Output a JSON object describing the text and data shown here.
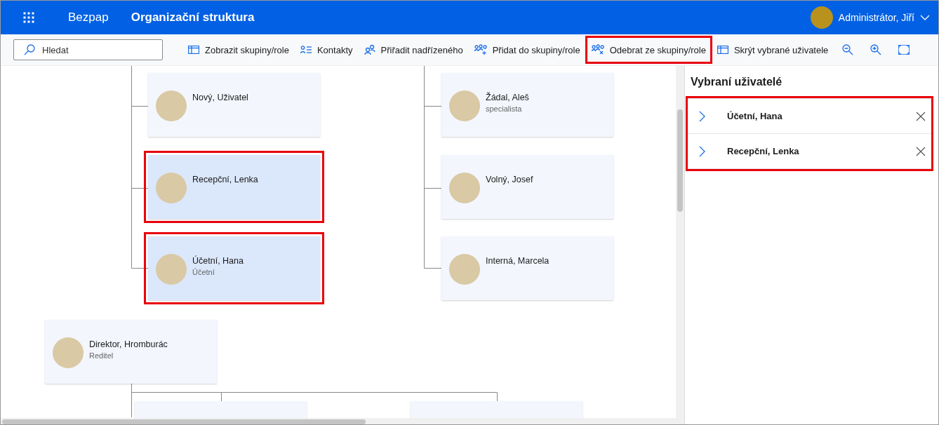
{
  "header": {
    "app_name": "Bezpap",
    "title": "Organizační struktura",
    "user": "Administrátor, Jiří"
  },
  "toolbar": {
    "search": {
      "placeholder": "Hledat"
    },
    "buttons": [
      {
        "label": "Zobrazit skupiny/role",
        "kind": "panel",
        "highlighted": false
      },
      {
        "label": "Kontakty",
        "kind": "contacts",
        "highlighted": false
      },
      {
        "label": "Přiřadit nadřízeného",
        "kind": "assign",
        "highlighted": false
      },
      {
        "label": "Přidat do skupiny/role",
        "kind": "add",
        "highlighted": false
      },
      {
        "label": "Odebrat ze skupiny/role",
        "kind": "remove",
        "highlighted": true
      },
      {
        "label": "Skrýt vybrané uživatele",
        "kind": "panel",
        "highlighted": false
      },
      {
        "kind": "zoom-out"
      },
      {
        "kind": "zoom-in"
      },
      {
        "kind": "fit"
      }
    ]
  },
  "chart": {
    "cards": [
      {
        "name": "Nový, Uživatel",
        "selected": false,
        "highlighted": false
      },
      {
        "name": "Žádal, Aleš",
        "role": "specialista",
        "selected": false,
        "highlighted": false
      },
      {
        "name": "Recepční, Lenka",
        "selected": true,
        "highlighted": true
      },
      {
        "name": "Volný, Josef",
        "selected": false,
        "highlighted": false
      },
      {
        "name": "Účetní, Hana",
        "role": "Účetní",
        "selected": true,
        "highlighted": true
      },
      {
        "name": "Interná, Marcela",
        "selected": false,
        "highlighted": false
      },
      {
        "name": "Direktor, Hromburác",
        "role": "Reditel",
        "selected": false,
        "highlighted": false
      }
    ]
  },
  "selected_panel": {
    "title": "Vybraní uživatelé",
    "highlighted": true,
    "users": [
      {
        "name": "Účetní, Hana"
      },
      {
        "name": "Recepční, Lenka"
      }
    ]
  }
}
